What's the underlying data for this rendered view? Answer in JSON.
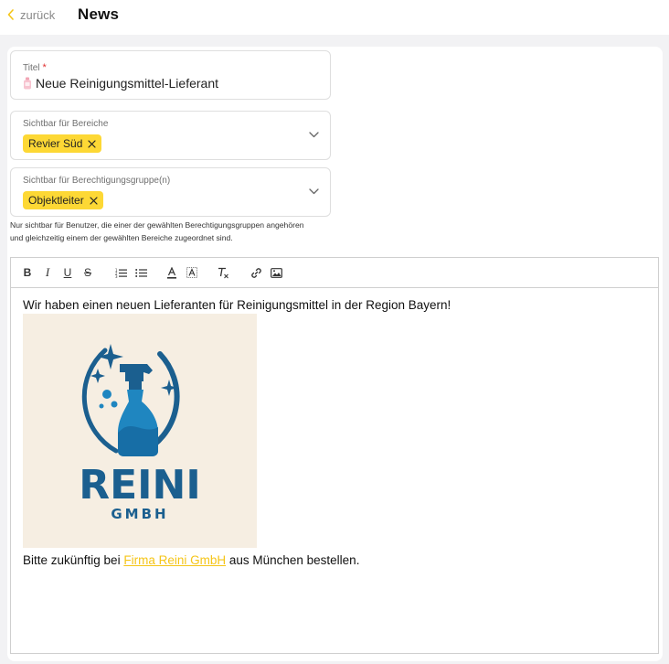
{
  "header": {
    "back_label": "zurück",
    "title": "News"
  },
  "form": {
    "title_field": {
      "label": "Titel",
      "required_mark": "*",
      "value": "Neue Reinigungsmittel-Lieferant"
    },
    "areas_field": {
      "label": "Sichtbar für Bereiche",
      "chips": [
        "Revier Süd"
      ]
    },
    "groups_field": {
      "label": "Sichtbar für Berechtigungsgruppe(n)",
      "chips": [
        "Objektleiter"
      ]
    },
    "hint_line1": "Nur sichtbar für Benutzer, die einer der gewählten Berechtigungsgruppen angehören",
    "hint_line2": "und gleichzeitig einem der gewählten Bereiche zugeordnet sind."
  },
  "editor": {
    "toolbar": {
      "bold": "B",
      "italic": "I",
      "underline": "U",
      "strike": "S"
    },
    "content": {
      "paragraph1": "Wir haben einen neuen Lieferanten für Reinigungsmittel in der Region Bayern!",
      "image": {
        "logo_main": "REINI",
        "logo_sub": "GMBH",
        "bg_color": "#f6eee2",
        "brand_color": "#1b5f8f",
        "accent_color": "#1f86c0"
      },
      "paragraph2_before": "Bitte zukünftig bei ",
      "paragraph2_link": "Firma Reini GmbH",
      "paragraph2_after": " aus München bestellen."
    }
  },
  "colors": {
    "accent": "#fdd835",
    "link": "#f5c518",
    "required": "#e03131"
  }
}
